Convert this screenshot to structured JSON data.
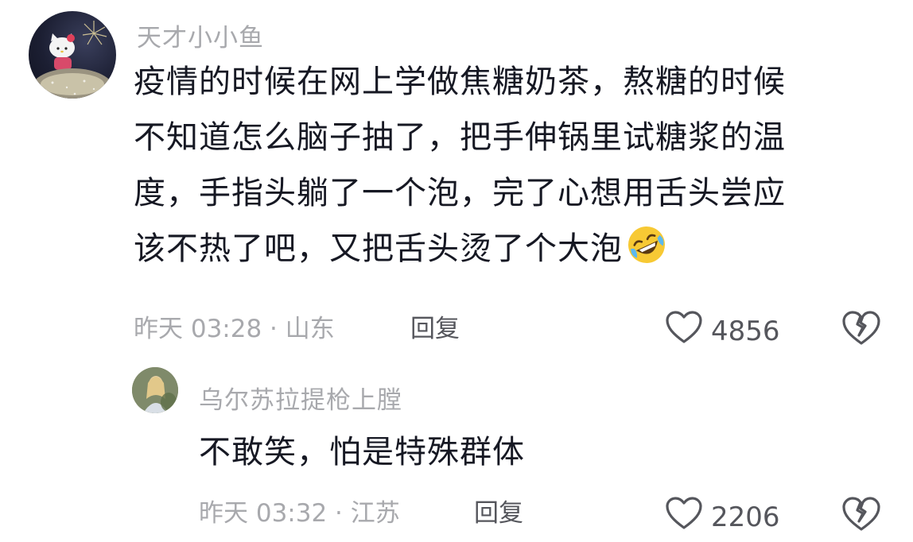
{
  "comment": {
    "username": "天才小小鱼",
    "lines": [
      "疫情的时候在网上学做焦糖奶茶，熬糖的时候",
      "不知道怎么脑子抽了，把手伸锅里试糖浆的温",
      "度，手指头躺了一个泡，完了心想用舌头尝应",
      "该不热了吧，又把舌头烫了个大泡"
    ],
    "emoji": "rolling-on-floor-laughing",
    "time_location": "昨天 03:28 · 山东",
    "reply_label": "回复",
    "like_count": "4856"
  },
  "reply": {
    "username": "乌尔苏拉提枪上膛",
    "text": "不敢笑，怕是特殊群体",
    "time_location": "昨天 03:32 · 江苏",
    "reply_label": "回复",
    "like_count": "2206"
  }
}
